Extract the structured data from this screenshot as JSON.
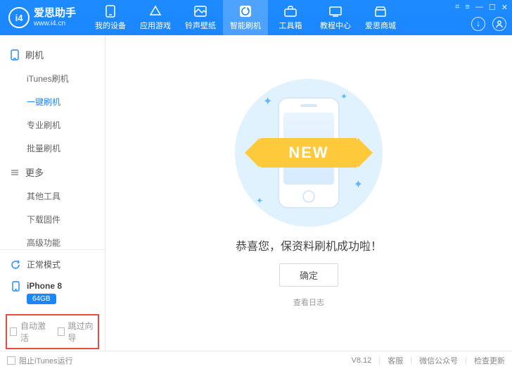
{
  "logo": {
    "badge": "i4",
    "title": "爱思助手",
    "subtitle": "www.i4.cn"
  },
  "nav": {
    "items": [
      {
        "label": "我的设备"
      },
      {
        "label": "应用游戏"
      },
      {
        "label": "铃声壁纸"
      },
      {
        "label": "智能刷机"
      },
      {
        "label": "工具箱"
      },
      {
        "label": "教程中心"
      },
      {
        "label": "爱思商城"
      }
    ],
    "active_index": 3
  },
  "sidebar": {
    "groups": [
      {
        "title": "刷机",
        "items": [
          "iTunes刷机",
          "一键刷机",
          "专业刷机",
          "批量刷机"
        ],
        "active_index": 1
      },
      {
        "title": "更多",
        "items": [
          "其他工具",
          "下载固件",
          "高级功能"
        ],
        "active_index": -1
      }
    ],
    "mode_label": "正常模式",
    "device_name": "iPhone 8",
    "capacity_badge": "64GB",
    "auto_activate_label": "自动激活",
    "skip_wizard_label": "跳过向导"
  },
  "main": {
    "ribbon_text": "NEW",
    "success_text": "恭喜您，保资料刷机成功啦！",
    "ok_label": "确定",
    "view_logs": "查看日志"
  },
  "footer": {
    "block_itunes_label": "阻止iTunes运行",
    "version": "V8.12",
    "links": [
      "客服",
      "微信公众号",
      "检查更新"
    ]
  }
}
